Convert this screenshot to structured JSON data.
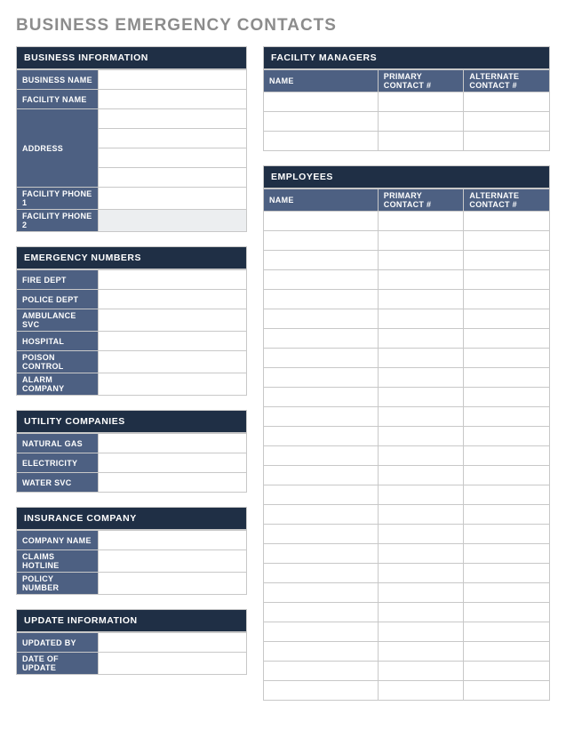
{
  "title": "BUSINESS EMERGENCY CONTACTS",
  "businessInfo": {
    "header": "BUSINESS INFORMATION",
    "fields": {
      "businessName": {
        "label": "BUSINESS NAME",
        "value": ""
      },
      "facilityName": {
        "label": "FACILITY NAME",
        "value": ""
      },
      "address": {
        "label": "ADDRESS",
        "lines": [
          "",
          "",
          "",
          ""
        ]
      },
      "facilityPhone1": {
        "label": "FACILITY PHONE 1",
        "value": ""
      },
      "facilityPhone2": {
        "label": "FACILITY PHONE 2",
        "value": ""
      }
    }
  },
  "emergencyNumbers": {
    "header": "EMERGENCY NUMBERS",
    "fields": {
      "fireDept": {
        "label": "FIRE DEPT",
        "value": ""
      },
      "policeDept": {
        "label": "POLICE DEPT",
        "value": ""
      },
      "ambulanceSvc": {
        "label": "AMBULANCE SVC",
        "value": ""
      },
      "hospital": {
        "label": "HOSPITAL",
        "value": ""
      },
      "poisonControl": {
        "label": "POISON CONTROL",
        "value": ""
      },
      "alarmCompany": {
        "label": "ALARM COMPANY",
        "value": ""
      }
    }
  },
  "utilityCompanies": {
    "header": "UTILITY COMPANIES",
    "fields": {
      "naturalGas": {
        "label": "NATURAL GAS",
        "value": ""
      },
      "electricity": {
        "label": "ELECTRICITY",
        "value": ""
      },
      "waterSvc": {
        "label": "WATER SVC",
        "value": ""
      }
    }
  },
  "insuranceCompany": {
    "header": "INSURANCE COMPANY",
    "fields": {
      "companyName": {
        "label": "COMPANY NAME",
        "value": ""
      },
      "claimsHotline": {
        "label": "CLAIMS HOTLINE",
        "value": ""
      },
      "policyNumber": {
        "label": "POLICY NUMBER",
        "value": ""
      }
    }
  },
  "updateInformation": {
    "header": "UPDATE INFORMATION",
    "fields": {
      "updatedBy": {
        "label": "UPDATED BY",
        "value": ""
      },
      "dateOfUpdate": {
        "label": "DATE OF UPDATE",
        "value": ""
      }
    }
  },
  "facilityManagers": {
    "header": "FACILITY MANAGERS",
    "columns": {
      "name": "NAME",
      "primary": "PRIMARY CONTACT #",
      "alternate": "ALTERNATE CONTACT #"
    },
    "rows": [
      {
        "name": "",
        "primary": "",
        "alternate": ""
      },
      {
        "name": "",
        "primary": "",
        "alternate": ""
      },
      {
        "name": "",
        "primary": "",
        "alternate": ""
      }
    ]
  },
  "employees": {
    "header": "EMPLOYEES",
    "columns": {
      "name": "NAME",
      "primary": "PRIMARY CONTACT #",
      "alternate": "ALTERNATE CONTACT #"
    },
    "rows": [
      {
        "name": "",
        "primary": "",
        "alternate": ""
      },
      {
        "name": "",
        "primary": "",
        "alternate": ""
      },
      {
        "name": "",
        "primary": "",
        "alternate": ""
      },
      {
        "name": "",
        "primary": "",
        "alternate": ""
      },
      {
        "name": "",
        "primary": "",
        "alternate": ""
      },
      {
        "name": "",
        "primary": "",
        "alternate": ""
      },
      {
        "name": "",
        "primary": "",
        "alternate": ""
      },
      {
        "name": "",
        "primary": "",
        "alternate": ""
      },
      {
        "name": "",
        "primary": "",
        "alternate": ""
      },
      {
        "name": "",
        "primary": "",
        "alternate": ""
      },
      {
        "name": "",
        "primary": "",
        "alternate": ""
      },
      {
        "name": "",
        "primary": "",
        "alternate": ""
      },
      {
        "name": "",
        "primary": "",
        "alternate": ""
      },
      {
        "name": "",
        "primary": "",
        "alternate": ""
      },
      {
        "name": "",
        "primary": "",
        "alternate": ""
      },
      {
        "name": "",
        "primary": "",
        "alternate": ""
      },
      {
        "name": "",
        "primary": "",
        "alternate": ""
      },
      {
        "name": "",
        "primary": "",
        "alternate": ""
      },
      {
        "name": "",
        "primary": "",
        "alternate": ""
      },
      {
        "name": "",
        "primary": "",
        "alternate": ""
      },
      {
        "name": "",
        "primary": "",
        "alternate": ""
      },
      {
        "name": "",
        "primary": "",
        "alternate": ""
      },
      {
        "name": "",
        "primary": "",
        "alternate": ""
      },
      {
        "name": "",
        "primary": "",
        "alternate": ""
      },
      {
        "name": "",
        "primary": "",
        "alternate": ""
      }
    ]
  }
}
